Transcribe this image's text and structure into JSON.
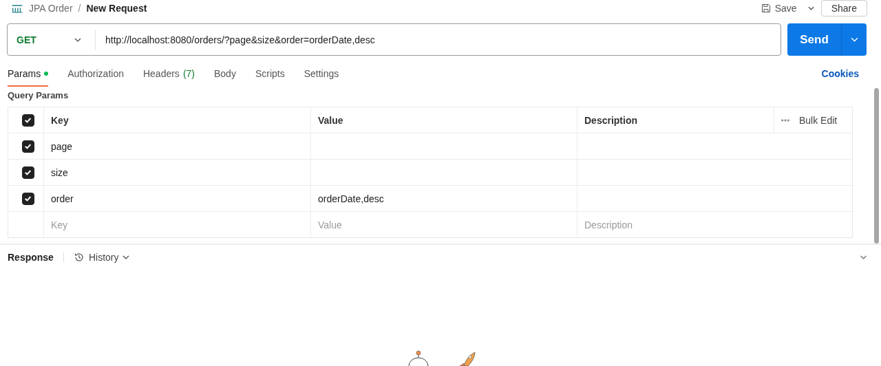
{
  "breadcrumb": {
    "collection": "JPA Order",
    "separator": "/",
    "request": "New Request"
  },
  "actions": {
    "save": "Save",
    "share": "Share"
  },
  "request": {
    "method": "GET",
    "url": "http://localhost:8080/orders/?page&size&order=orderDate,desc"
  },
  "send": "Send",
  "tabs": [
    {
      "label": "Params",
      "selected": true,
      "dot": true
    },
    {
      "label": "Authorization",
      "selected": false,
      "dot": false
    },
    {
      "label": "Headers",
      "count": "(7)",
      "selected": false,
      "dot": false
    },
    {
      "label": "Body",
      "selected": false,
      "dot": false
    },
    {
      "label": "Scripts",
      "selected": false,
      "dot": false
    },
    {
      "label": "Settings",
      "selected": false,
      "dot": false
    }
  ],
  "cookies": "Cookies",
  "query_params": {
    "title": "Query Params",
    "all_checked": true,
    "columns": [
      "Key",
      "Value",
      "Description"
    ],
    "bulk_edit": "Bulk Edit",
    "rows": [
      {
        "checked": true,
        "key": "page",
        "value": ""
      },
      {
        "checked": true,
        "key": "size",
        "value": ""
      },
      {
        "checked": true,
        "key": "order",
        "value": "orderDate,desc"
      }
    ],
    "placeholders": {
      "key": "Key",
      "value": "Value",
      "description": "Description"
    }
  },
  "response": {
    "label": "Response",
    "history": "History"
  }
}
